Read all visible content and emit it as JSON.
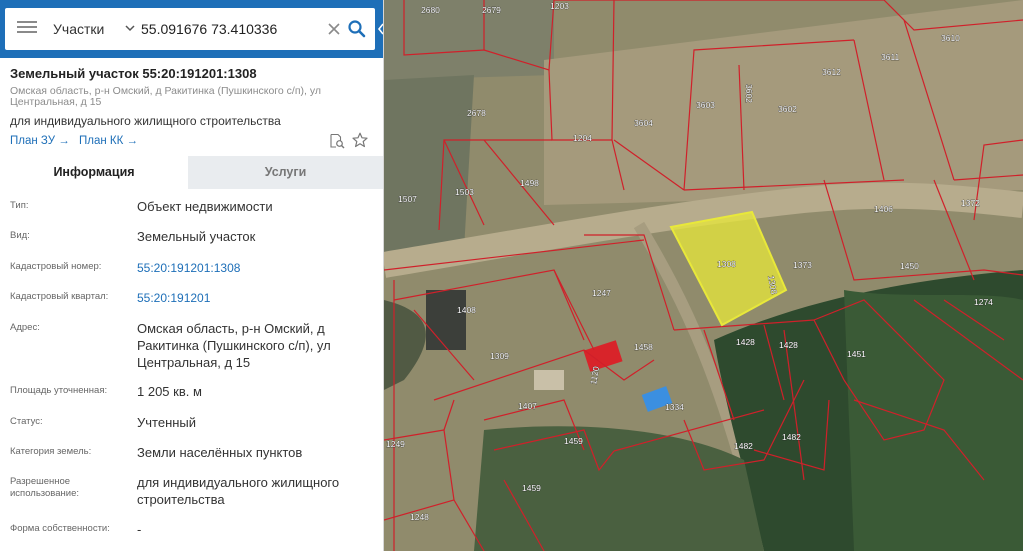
{
  "search": {
    "layer": "Участки",
    "query": "55.091676 73.410336"
  },
  "object": {
    "title": "Земельный участок 55:20:191201:1308",
    "address_line": "Омская область, р-н Омский, д Ракитинка (Пушкинского с/п), ул Центральная, д 15",
    "purpose": "для индивидуального жилищного строительства",
    "links": [
      "План ЗУ →",
      "План КК →"
    ]
  },
  "tabs": [
    "Информация",
    "Услуги"
  ],
  "info_rows": [
    {
      "label": "Тип:",
      "value": "Объект недвижимости",
      "link": false
    },
    {
      "label": "Вид:",
      "value": "Земельный участок",
      "link": false
    },
    {
      "label": "Кадастровый номер:",
      "value": "55:20:191201:1308",
      "link": true
    },
    {
      "label": "Кадастровый квартал:",
      "value": "55:20:191201",
      "link": true
    },
    {
      "label": "Адрес:",
      "value": "Омская область, р-н Омский, д Ракитинка (Пушкинского с/п), ул Центральная, д 15",
      "link": false
    },
    {
      "label": "Площадь уточненная:",
      "value": "1 205 кв. м",
      "link": false
    },
    {
      "label": "Статус:",
      "value": "Учтенный",
      "link": false
    },
    {
      "label": "Категория земель:",
      "value": "Земли населённых пунктов",
      "link": false
    },
    {
      "label": "Разрешенное использование:",
      "value": "для индивидуального жилищного строительства",
      "link": false
    },
    {
      "label": "Форма собственности:",
      "value": "-",
      "link": false
    }
  ],
  "map": {
    "highlight_color": "#e8e83a",
    "boundary_color": "#d0202a",
    "parcel_labels": [
      "2680",
      "2679",
      "1203",
      "3610",
      "3611",
      "3612",
      "3603",
      "3602",
      "3602",
      "2678",
      "3604",
      "1204",
      "1507",
      "1503",
      "1498",
      "1406",
      "1372",
      "1308",
      "1308",
      "1373",
      "1450",
      "1274",
      "1408",
      "1247",
      "1309",
      "1458",
      "1428",
      "1428",
      "1451",
      "1120",
      "1407",
      "1334",
      "1459",
      "1482",
      "1482",
      "1249",
      "1459",
      "1248"
    ]
  }
}
